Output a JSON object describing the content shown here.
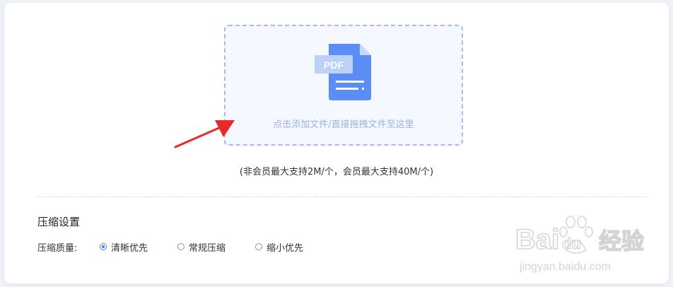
{
  "upload": {
    "drop_text": "点击添加文件/直接拖拽文件至这里",
    "icon_badge": "PDF",
    "limit_note": "(非会员最大支持2M/个，会员最大支持40M/个)"
  },
  "settings": {
    "title": "压缩设置",
    "quality_label": "压缩质量:",
    "options": [
      {
        "label": "清晰优先",
        "checked": true
      },
      {
        "label": "常规压缩",
        "checked": false
      },
      {
        "label": "缩小优先",
        "checked": false
      }
    ]
  },
  "watermark": {
    "brand_left": "Bai",
    "brand_right": "du",
    "brand_cn": "经验",
    "url": "jingyan.baidu.com"
  },
  "colors": {
    "accent": "#3a7ff0",
    "dropzone_border": "#a3bdf0",
    "icon_blue": "#5b8ef5",
    "annotation_arrow": "#e8282b"
  }
}
